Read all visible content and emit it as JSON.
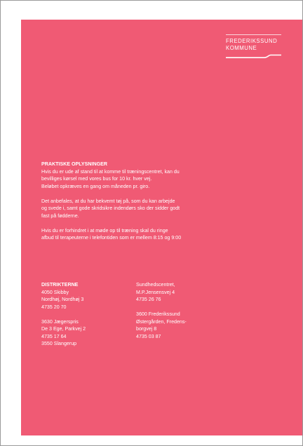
{
  "logo": {
    "line1": "FREDERIKSSUND",
    "line2": "KOMMUNE"
  },
  "practical": {
    "heading": "PRAKTISKE OPLYSNINGER",
    "para1": [
      "Hvis du er ude af stand til at komme til træningscentret, kan du",
      "bevilliges kørsel med vores bus for 10 kr. hver vej.",
      "Beløbet opkræves en gang om måneden pr. giro."
    ],
    "para2": [
      "Det anbefales, at du har bekvemt tøj på, som du kan arbejde",
      "og svede i, samt gode skridsikre indendørs sko der sidder godt",
      "fast på fødderne."
    ],
    "para3": [
      "Hvis du er forhindret i at møde op til træning skal du ringe",
      "afbud til terapeuterne i telefontiden som er mellem 8:15 og 9:00"
    ]
  },
  "districts": {
    "heading": "DISTRIKTERNE",
    "left": {
      "block1": [
        "4050 Skibby",
        "Nordhøj, Nordhøj 3",
        "4735 20 70"
      ],
      "block2": [
        "3630 Jægerspris",
        "De 3 Ege, Parkvej 2",
        "4735 17 64",
        "3550 Slangerup"
      ]
    },
    "right": {
      "block1": [
        "Sundhedscentret,",
        "M.P.Jensensvej 4",
        "4735 26 76"
      ],
      "block2": [
        "3600 Frederikssund",
        "Østergården, Fredens-",
        "borgvej 8",
        "4735 03 87"
      ]
    }
  }
}
